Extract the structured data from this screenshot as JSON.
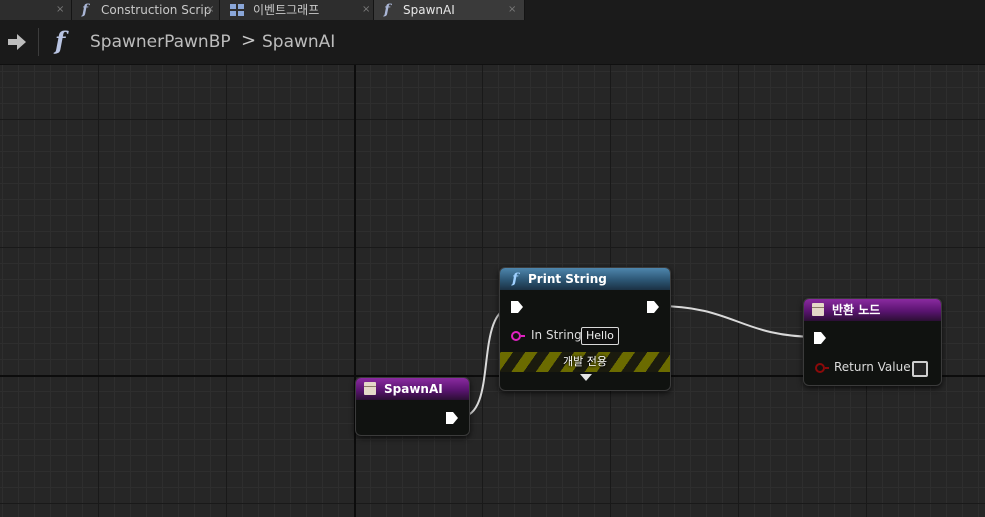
{
  "tabs": [
    {
      "label": "",
      "icon": "none",
      "active": false
    },
    {
      "label": "Construction Scrip",
      "icon": "function-icon",
      "active": false
    },
    {
      "label": "이벤트그래프",
      "icon": "event-graph-icon",
      "active": false
    },
    {
      "label": "SpawnAI",
      "icon": "function-icon",
      "active": true
    }
  ],
  "tab_close_glyph": "×",
  "breadcrumb": {
    "blueprint": "SpawnerPawnBP",
    "separator": ">",
    "function": "SpawnAI",
    "icon": "function-icon"
  },
  "nodes": {
    "entry": {
      "title": "SpawnAI",
      "color": "#6b1a80"
    },
    "print": {
      "title": "Print String",
      "color": "#2f5a78",
      "in_string_label": "In String",
      "in_string_value": "Hello",
      "dev_only_label": "개발 전용"
    },
    "return": {
      "title": "반환 노드",
      "color": "#6b1a80",
      "return_value_label": "Return Value",
      "return_value_checked": false
    }
  },
  "pin_colors": {
    "exec": "#ffffff",
    "string": "#e021c2",
    "bool": "#8b0a0a"
  }
}
